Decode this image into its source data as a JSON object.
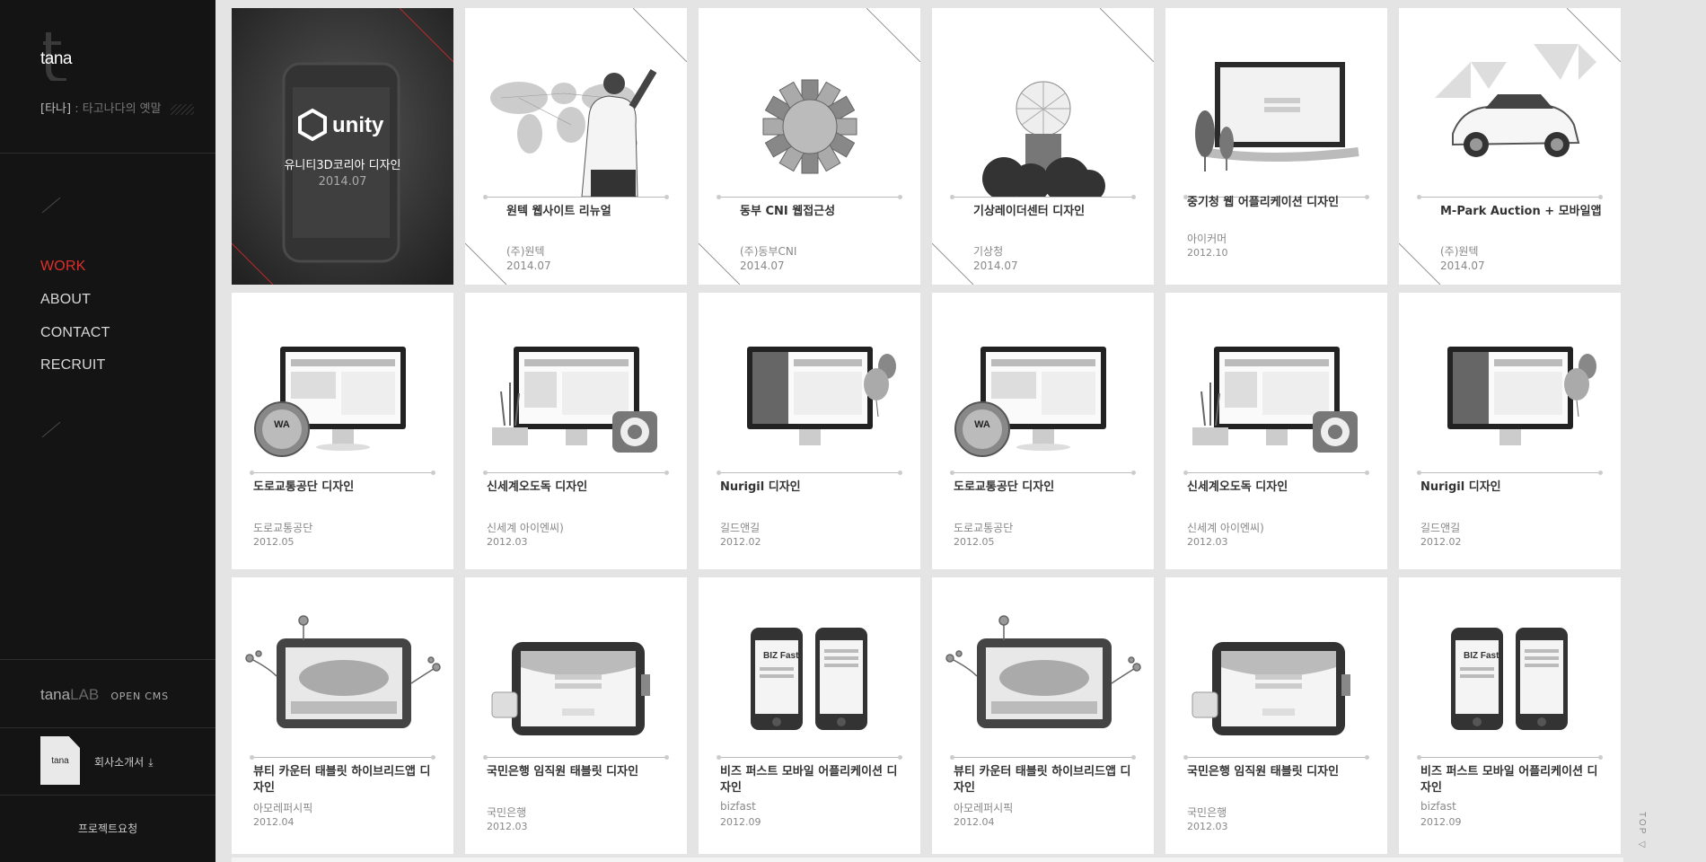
{
  "brand": {
    "logo_text": "tana",
    "tagline_brand": "[타나]",
    "tagline_separator": ":",
    "tagline_desc": "타고나다의 옛말"
  },
  "nav": {
    "items": [
      {
        "label": "WORK",
        "active": true
      },
      {
        "label": "ABOUT",
        "active": false
      },
      {
        "label": "CONTACT",
        "active": false
      },
      {
        "label": "RECRUIT",
        "active": false
      }
    ]
  },
  "lab": {
    "tana": "tana",
    "lab": "LAB",
    "cms": "OPEN CMS"
  },
  "brochure": {
    "doc_text": "tana",
    "label": "회사소개서",
    "icon": "download-icon"
  },
  "request": {
    "label": "프로젝트요청"
  },
  "top_button": {
    "label": "TOP"
  },
  "colors": {
    "accent": "#e0302b",
    "sidebar_bg": "#141414",
    "page_bg": "#e4e4e4"
  },
  "works": [
    {
      "title": "유니티3D코리아 디자인",
      "client": "",
      "date": "2014.07",
      "featured": true,
      "logo": "unity",
      "thumb": "unity-phone"
    },
    {
      "title": "원텍 웹사이트 리뉴얼",
      "client": "(주)원텍",
      "date": "2014.07",
      "thumb": "world-man"
    },
    {
      "title": "동부 CNI 웹접근성",
      "client": "(주)동부CNI",
      "date": "2014.07",
      "thumb": "gear"
    },
    {
      "title": "기상레이더센터 디자인",
      "client": "기상청",
      "date": "2014.07",
      "thumb": "radar"
    },
    {
      "title": "중기청 웹 어플리케이션 디자인",
      "client": "아이커머",
      "date": "2012.10",
      "thumb": "monitor-trees"
    },
    {
      "title": "M-Park Auction + 모바일앱",
      "client": "(주)원텍",
      "date": "2014.07",
      "thumb": "car"
    },
    {
      "title": "도로교통공단 디자인",
      "client": "도로교통공단",
      "date": "2012.05",
      "thumb": "monitor-badge"
    },
    {
      "title": "신세계오도독 디자인",
      "client": "신세계 아이엔씨)",
      "date": "2012.03",
      "thumb": "monitor-camera"
    },
    {
      "title": "Nurigil 디자인",
      "client": "길드앤길",
      "date": "2012.02",
      "thumb": "monitor-balloon"
    },
    {
      "title": "도로교통공단 디자인",
      "client": "도로교통공단",
      "date": "2012.05",
      "thumb": "monitor-badge"
    },
    {
      "title": "신세계오도독 디자인",
      "client": "신세계 아이엔씨)",
      "date": "2012.03",
      "thumb": "monitor-camera"
    },
    {
      "title": "Nurigil 디자인",
      "client": "길드앤길",
      "date": "2012.02",
      "thumb": "monitor-balloon"
    },
    {
      "title": "뷰티 카운터 태블릿 하이브리드앱 디자인",
      "client": "아모레퍼시픽",
      "date": "2012.04",
      "thumb": "tablet-flowers"
    },
    {
      "title": "국민은행 임직원 태블릿 디자인",
      "client": "국민은행",
      "date": "2012.03",
      "thumb": "tablet-kb"
    },
    {
      "title": "비즈 퍼스트 모바일 어플리케이션 디자인",
      "client": "bizfast",
      "date": "2012.09",
      "thumb": "phones"
    },
    {
      "title": "뷰티 카운터 태블릿 하이브리드앱 디자인",
      "client": "아모레퍼시픽",
      "date": "2012.04",
      "thumb": "tablet-flowers"
    },
    {
      "title": "국민은행 임직원 태블릿 디자인",
      "client": "국민은행",
      "date": "2012.03",
      "thumb": "tablet-kb"
    },
    {
      "title": "비즈 퍼스트 모바일 어플리케이션 디자인",
      "client": "bizfast",
      "date": "2012.09",
      "thumb": "phones"
    }
  ]
}
